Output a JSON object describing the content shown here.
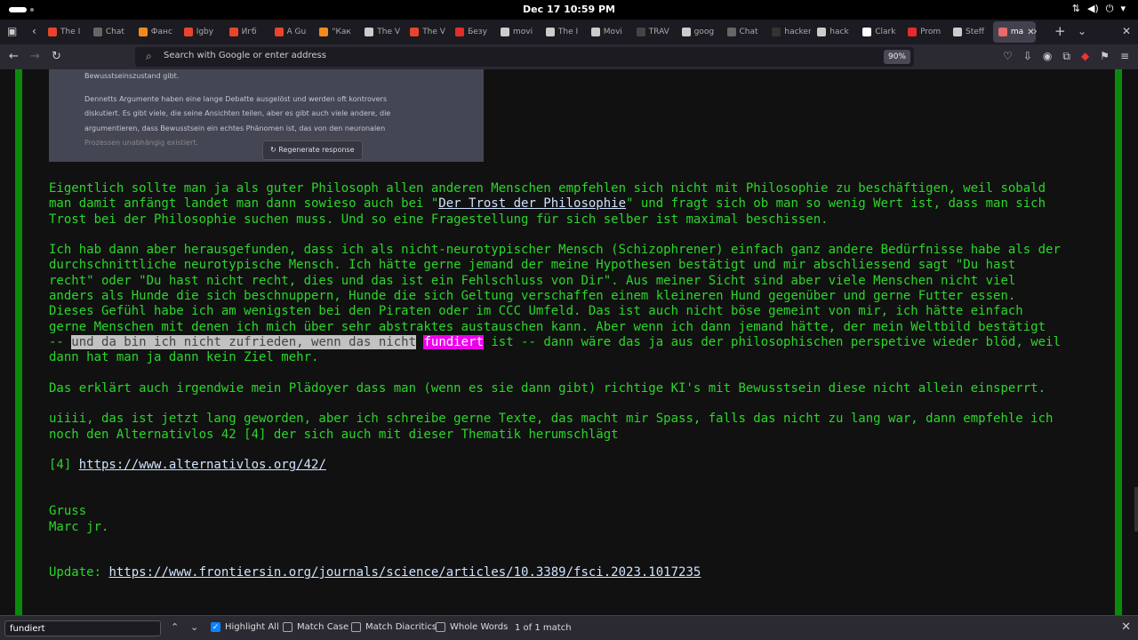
{
  "system": {
    "clock": "Dec 17  10:59 PM"
  },
  "tabs": [
    {
      "label": "The I",
      "color": "#e8452c"
    },
    {
      "label": "Chat",
      "color": "#666"
    },
    {
      "label": "Фанс",
      "color": "#f28b1b"
    },
    {
      "label": "Igby",
      "color": "#e8452c"
    },
    {
      "label": "Игб",
      "color": "#e8452c"
    },
    {
      "label": "A Gu",
      "color": "#e8452c"
    },
    {
      "label": "\"Как",
      "color": "#f28b1b"
    },
    {
      "label": "The V",
      "color": "#ccc"
    },
    {
      "label": "The V",
      "color": "#e8452c"
    },
    {
      "label": "Безу",
      "color": "#e62b2b"
    },
    {
      "label": "movi",
      "color": "#ccc"
    },
    {
      "label": "The I",
      "color": "#ccc"
    },
    {
      "label": "Movi",
      "color": "#ccc"
    },
    {
      "label": "TRAV",
      "color": "#444"
    },
    {
      "label": "goog",
      "color": "#ccc"
    },
    {
      "label": "Chat",
      "color": "#666"
    },
    {
      "label": "hackers",
      "color": "#333"
    },
    {
      "label": "hack",
      "color": "#ccc"
    },
    {
      "label": "Clark",
      "color": "#fff"
    },
    {
      "label": "Prom",
      "color": "#e62b2b"
    },
    {
      "label": "Steff",
      "color": "#ccc"
    },
    {
      "label": "ma",
      "color": "#e86a6a"
    }
  ],
  "address": {
    "placeholder": "Search with Google or enter address",
    "zoom": "90%"
  },
  "embedded_screenshot": {
    "line1": "Bewusstseinszustand gibt.",
    "para": [
      "Dennetts Argumente haben eine lange Debatte ausgelöst und werden oft kontrovers",
      "diskutiert. Es gibt viele, die seine Ansichten teilen, aber es gibt auch viele andere, die",
      "argumentieren, dass Bewusstsein ein echtes Phänomen ist, das von den neuronalen",
      "Prozessen unabhängig existiert."
    ],
    "regenerate": "Regenerate response"
  },
  "content": {
    "p1_a": "Eigentlich sollte man ja als guter Philosoph allen anderen Menschen empfehlen sich nicht mit Philosophie zu beschäftigen, weil sobald\nman damit anfängt landet man dann sowieso auch bei \"",
    "p1_link": "Der Trost der Philosophie",
    "p1_b": "\" und fragt sich ob man so wenig Wert ist, dass man sich\nTrost bei der Philosophie suchen muss. Und so eine Fragestellung für sich selber ist maximal beschissen.\n\n",
    "p2_a": "Ich hab dann aber herausgefunden, dass ich als nicht-neurotypischer Mensch (Schizophrener) einfach ganz andere Bedürfnisse habe als der\ndurchschnittliche neurotypische Mensch. Ich hätte gerne jemand der meine Hypothesen bestätigt und mir abschliessend sagt \"Du hast\nrecht\" oder \"Du hast nicht recht, dies und das ist ein Fehlschluss von Dir\". Aus meiner Sicht sind aber viele Menschen nicht viel\nanders als Hunde die sich beschnuppern, Hunde die sich Geltung verschaffen einem kleineren Hund gegenüber und gerne Futter essen.\nDieses Gefühl habe ich am wenigsten bei den Piraten oder im CCC Umfeld. Das ist auch nicht böse gemeint von mir, ich hätte einfach\ngerne Menschen mit denen ich mich über sehr abstraktes austauschen kann. Aber wenn ich dann jemand hätte, der mein Weltbild bestätigt\n-- ",
    "p2_sel": "und da bin ich nicht zufrieden, wenn das nicht",
    "p2_space": " ",
    "p2_match": "fundiert",
    "p2_b": " ist -- dann wäre das ja aus der philosophischen perspetive wieder blöd, weil\ndann hat man ja dann kein Ziel mehr.\n\n",
    "p3": "Das erklärt auch irgendwie mein Plädoyer dass man (wenn es sie dann gibt) richtige KI's mit Bewusstsein diese nicht allein einsperrt.\n\nuiiii, das ist jetzt lang geworden, aber ich schreibe gerne Texte, das macht mir Spass, falls das nicht zu lang war, dann empfehle ich\nnoch den Alternativlos 42 [4] der sich auch mit dieser Thematik herumschlägt\n\n[4] ",
    "ref_link": "https://www.alternativlos.org/42/",
    "p4": "\n\n\nGruss\nMarc jr.\n\n\nUpdate: ",
    "update_link": "https://www.frontiersin.org/journals/science/articles/10.3389/fsci.2023.1017235"
  },
  "findbar": {
    "query": "fundiert",
    "highlight_all": "Highlight All",
    "match_case": "Match Case",
    "match_diacritics": "Match Diacritics",
    "whole_words": "Whole Words",
    "result": "1 of 1 match"
  }
}
